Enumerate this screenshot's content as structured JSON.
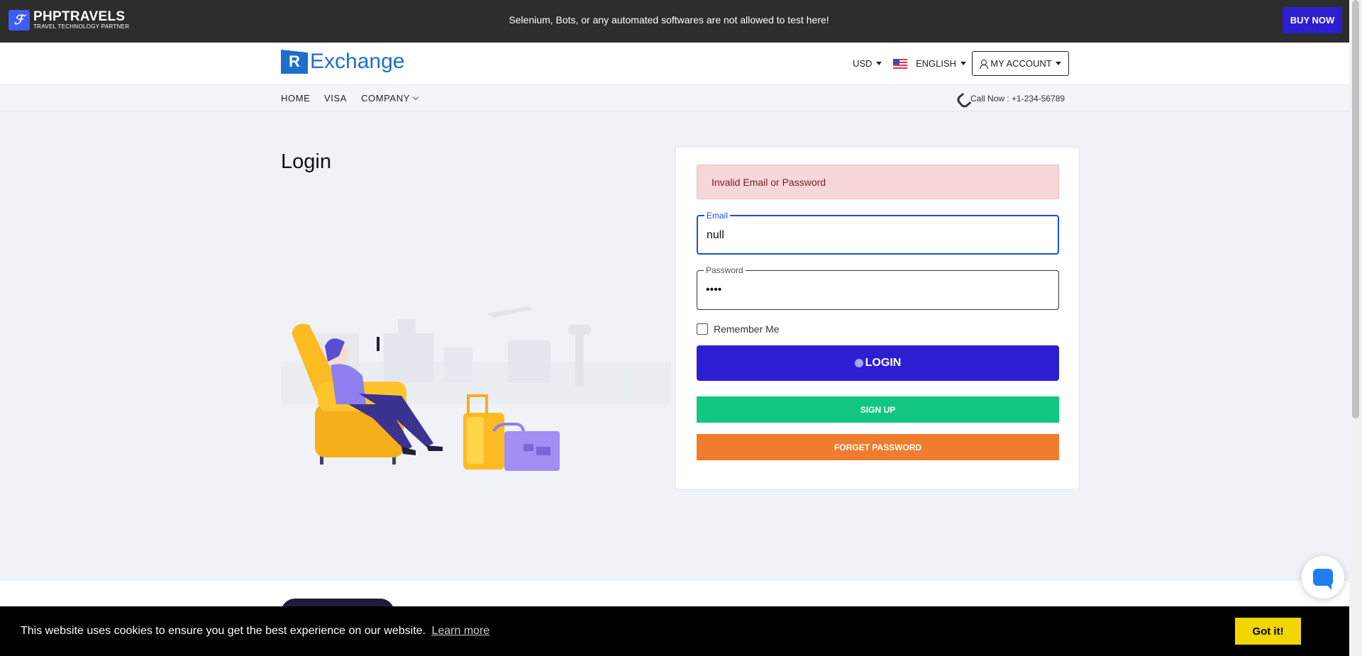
{
  "promo": {
    "brand_name": "PHPTRAVELS",
    "brand_tagline": "TRAVEL TECHNOLOGY PARTNER",
    "notice": "Selenium, Bots, or any automated softwares are not allowed to test here!",
    "buy_now": "BUY NOW"
  },
  "header": {
    "logo_text": "Exchange",
    "currency": "USD",
    "language": "ENGLISH",
    "account": "MY ACCOUNT"
  },
  "nav": {
    "items": [
      "HOME",
      "VISA",
      "COMPANY"
    ],
    "call_now": "Call Now : +1-234-56789"
  },
  "main": {
    "title": "Login"
  },
  "login_form": {
    "error": "Invalid Email or Password",
    "email_label": "Email",
    "email_value": "null",
    "password_label": "Password",
    "password_value": "null",
    "remember_me": "Remember Me",
    "login_button": "LOGIN",
    "signup_button": "SIGN UP",
    "forget_button": "FORGET PASSWORD"
  },
  "cookie": {
    "message": "This website uses cookies to ensure you get the best experience on our website.",
    "learn_more": "Learn more",
    "accept": "Got it!"
  },
  "colors": {
    "primary": "#2b1fd1",
    "success": "#11c680",
    "warning": "#ef7d2d",
    "alert_bg": "#f8d7da",
    "cookie_accept": "#f1d600"
  }
}
